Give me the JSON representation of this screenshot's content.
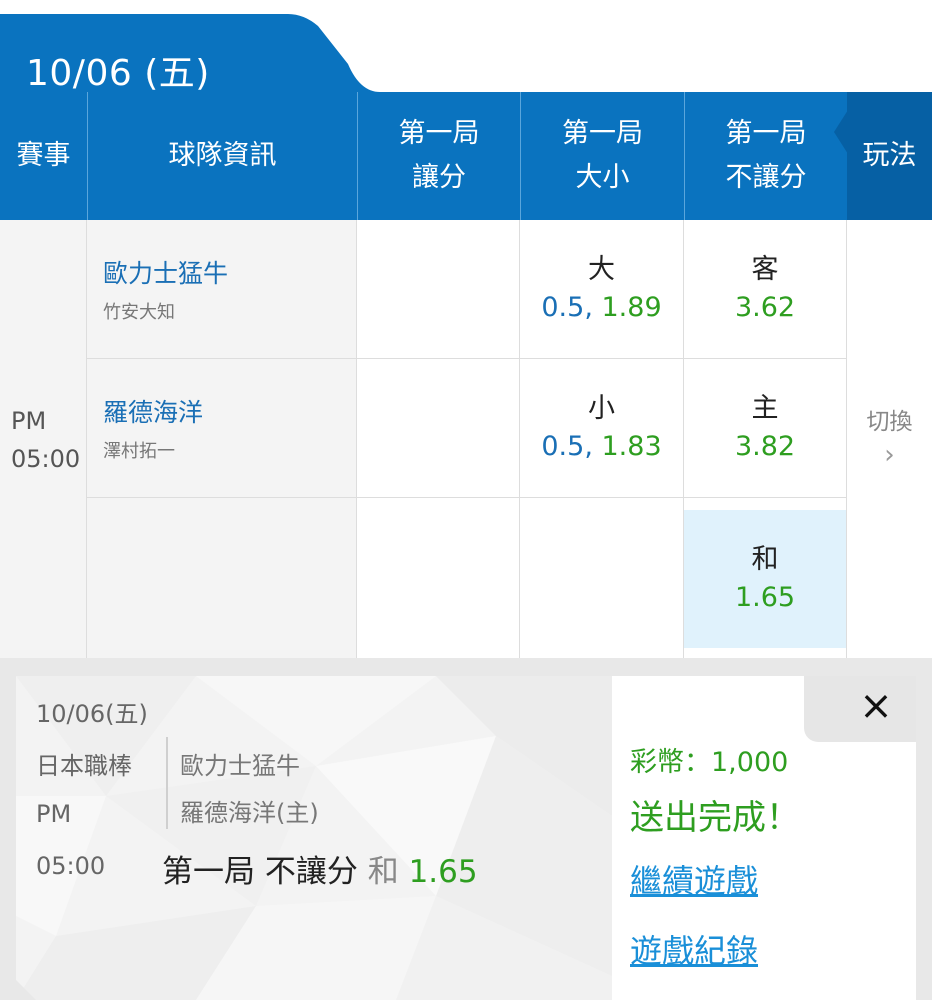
{
  "header": {
    "date": "10/06 (五)",
    "columns": {
      "event": "賽事",
      "team_info": "球隊資訊",
      "handicap": [
        "第一局",
        "讓分"
      ],
      "over_under": [
        "第一局",
        "大小"
      ],
      "moneyline": [
        "第一局",
        "不讓分"
      ],
      "play": "玩法"
    }
  },
  "match": {
    "time": [
      "PM",
      "05:00"
    ],
    "teams": [
      {
        "name": "歐力士猛牛",
        "pitcher": "竹安大知"
      },
      {
        "name": "羅德海洋",
        "pitcher": "澤村拓一"
      }
    ],
    "over_under": [
      {
        "label": "大",
        "line": "0.5,",
        "odds": "1.89"
      },
      {
        "label": "小",
        "line": "0.5,",
        "odds": "1.83"
      }
    ],
    "moneyline": [
      {
        "label": "客",
        "odds": "3.62"
      },
      {
        "label": "主",
        "odds": "3.82"
      },
      {
        "label": "和",
        "odds": "1.65"
      }
    ],
    "switch_label": "切換",
    "switch_chevron": "›"
  },
  "ticket": {
    "date": "10/06(五)",
    "league": "日本職棒",
    "time_pm": "PM",
    "time": "05:00",
    "team_away": "歐力士猛牛",
    "team_home": "羅德海洋(主)",
    "bet_market": "第一局 不讓分",
    "bet_option": "和",
    "bet_odds": "1.65",
    "coins": "彩幣：1,000",
    "status": "送出完成！",
    "continue_link": "繼續遊戲",
    "history_link": "遊戲紀錄",
    "close": "×"
  },
  "colors": {
    "header_blue": "#0a73bf",
    "header_dark": "#0660a4",
    "team_blue": "#1a6fb5",
    "odds_green": "#2e9e20",
    "selected_bg": "#e0f2fc",
    "link_blue": "#1a8fd8"
  }
}
